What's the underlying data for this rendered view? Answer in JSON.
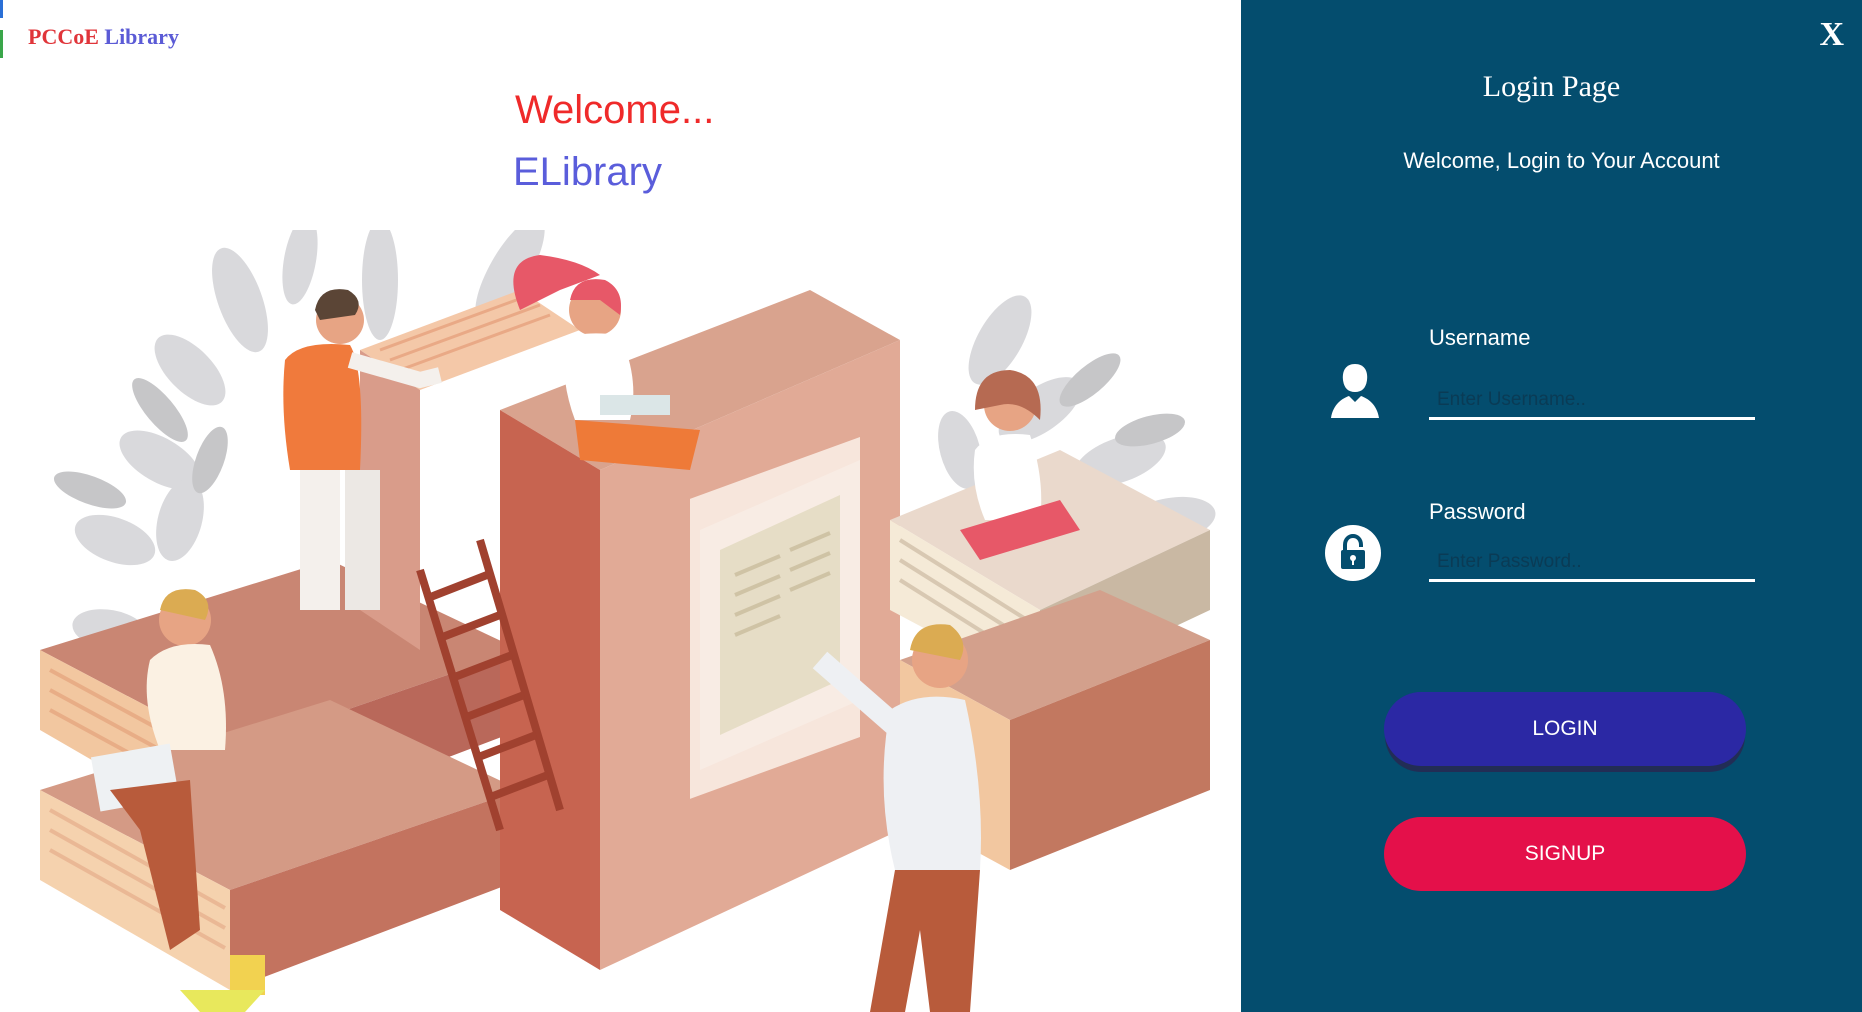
{
  "app": {
    "brand_part1": "PCCoE",
    "brand_part2": "Library"
  },
  "hero": {
    "welcome": "Welcome...",
    "subtitle": "ELibrary"
  },
  "login_panel": {
    "close_label": "X",
    "title": "Login Page",
    "subtitle": "Welcome, Login to Your Account",
    "username": {
      "label": "Username",
      "placeholder": "Enter Username.."
    },
    "password": {
      "label": "Password",
      "placeholder": "Enter Password.."
    },
    "login_button": "LOGIN",
    "signup_button": "SIGNUP"
  },
  "icons": [
    "user-icon",
    "lock-icon",
    "close-icon"
  ],
  "colors": {
    "panel_bg": "#044d6e",
    "login_button": "#2b28a4",
    "signup_button": "#e4104a",
    "brand_red": "#e0353a",
    "brand_purple": "#5b5bd6",
    "welcome_red": "#ef2a2a",
    "elibrary_purple": "#5a5ddb"
  }
}
